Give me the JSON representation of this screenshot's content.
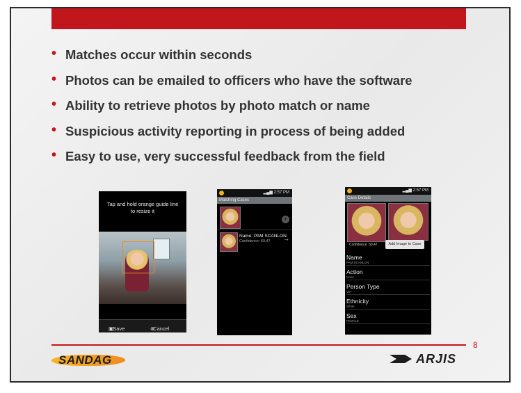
{
  "bullets": [
    "Matches occur within seconds",
    "Photos can be emailed to officers who have the software",
    "Ability to retrieve photos by photo match or name",
    "Suspicious activity reporting in process of being added",
    "Easy to use, very successful feedback from the field"
  ],
  "phone1": {
    "hint_line1": "Tap and hold orange guide line",
    "hint_line2": "to resize it",
    "save_label": "Save",
    "cancel_label": "Cancel"
  },
  "phone2": {
    "time": "2:57 PM",
    "title": "Matching Cases",
    "match_name": "Name: PAM SCANLON",
    "match_confidence": "Confidence: 69.47"
  },
  "phone3": {
    "time": "2:57 PM",
    "title": "Case Details",
    "confidence": "Confidence: 69.47",
    "add_button": "Add Image to Case",
    "fields": [
      {
        "label": "Name",
        "value": "PAM SCANLON"
      },
      {
        "label": "Action",
        "value": "None"
      },
      {
        "label": "Person Type",
        "value": "VIP"
      },
      {
        "label": "Ethnicity",
        "value": "White"
      },
      {
        "label": "Sex",
        "value": "FEMALE"
      }
    ]
  },
  "footer": {
    "page_number": "8",
    "logo_left": "SANDAG",
    "logo_right": "ARJIS"
  },
  "colors": {
    "accent": "#c0161c",
    "text": "#333333",
    "logo_orange": "#f6b52a"
  }
}
